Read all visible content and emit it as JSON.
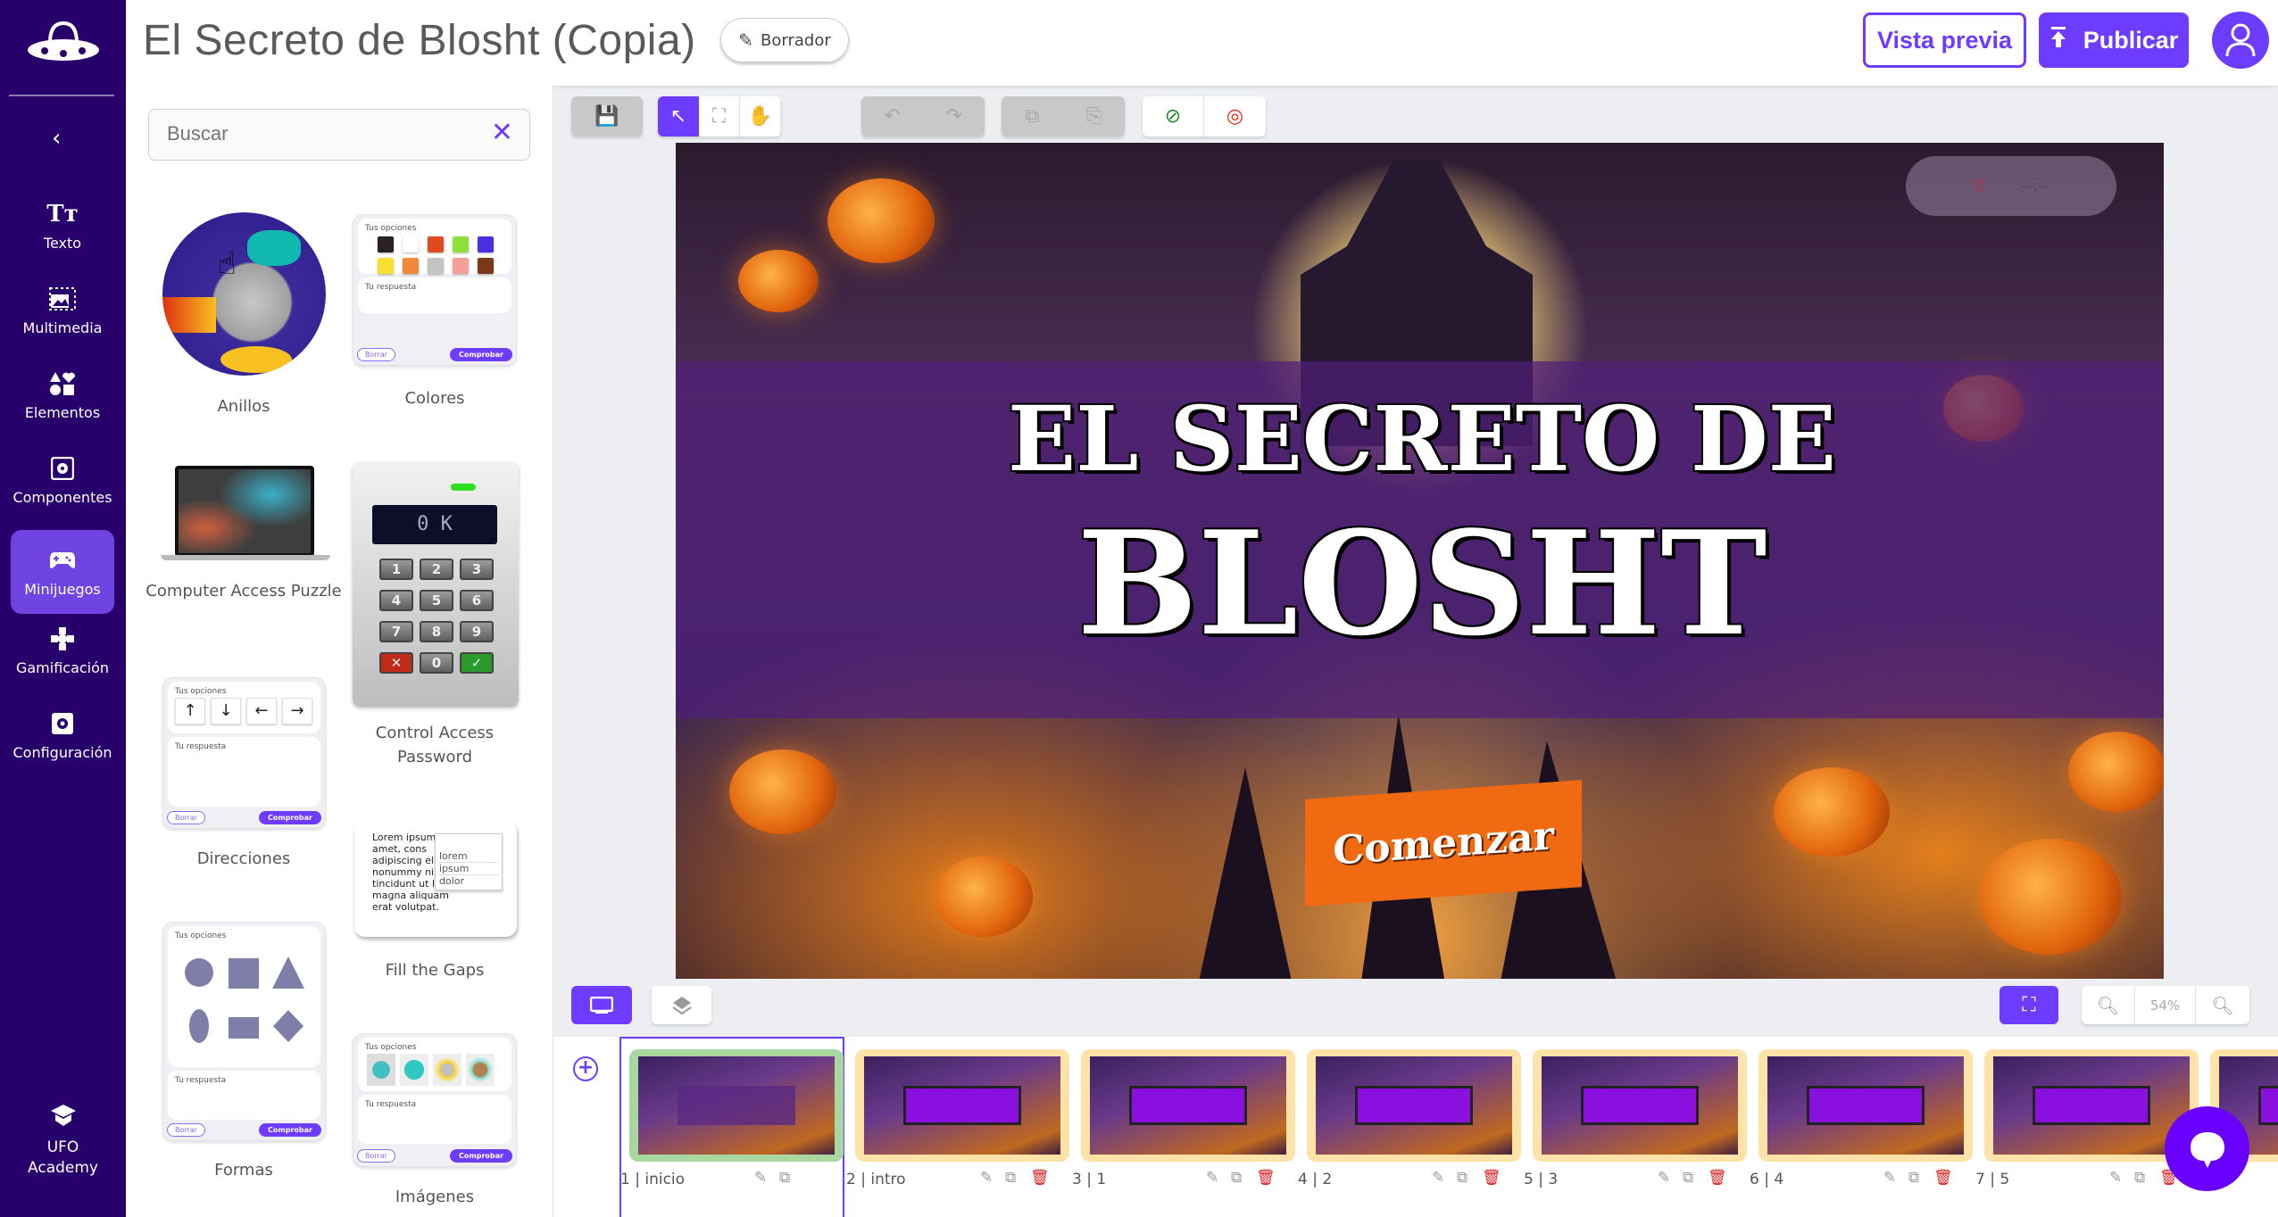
{
  "header": {
    "title": "El Secreto de Blosht (Copia)",
    "status_label": "Borrador",
    "preview_label": "Vista previa",
    "publish_label": "Publicar"
  },
  "sidebar": {
    "items": [
      {
        "label": "Texto",
        "icon": "text-icon"
      },
      {
        "label": "Multimedia",
        "icon": "image-icon"
      },
      {
        "label": "Elementos",
        "icon": "shapes-icon"
      },
      {
        "label": "Componentes",
        "icon": "component-icon"
      },
      {
        "label": "Minijuegos",
        "icon": "gamepad-icon",
        "active": true
      },
      {
        "label": "Gamificación",
        "icon": "puzzle-icon"
      },
      {
        "label": "Configuración",
        "icon": "settings-icon"
      }
    ],
    "academy_label_1": "UFO",
    "academy_label_2": "Academy"
  },
  "search": {
    "placeholder": "Buscar"
  },
  "minigames": {
    "items": [
      {
        "label": "Anillos"
      },
      {
        "label": "Colores"
      },
      {
        "label": "Computer Access Puzzle"
      },
      {
        "label": "Control Access Password"
      },
      {
        "label": "Direcciones"
      },
      {
        "label": "Fill the Gaps"
      },
      {
        "label": "Formas"
      },
      {
        "label": "Imágenes"
      }
    ],
    "options_label": "Tus opciones",
    "answer_label": "Tu respuesta",
    "clear_label": "Borrar",
    "check_label": "Comprobar",
    "colors": [
      "#2a2222",
      "#ffffff",
      "#e04a1c",
      "#8ee03a",
      "#4a30e0",
      "#f8e030",
      "#f08a3a",
      "#c4c4c4",
      "#f4a098",
      "#7a3a1a"
    ],
    "keypad": {
      "display": "0 K",
      "keys": [
        "1",
        "2",
        "3",
        "4",
        "5",
        "6",
        "7",
        "8",
        "9",
        "✕",
        "0",
        "✓"
      ]
    },
    "arrows": [
      "↑",
      "↓",
      "←",
      "→"
    ],
    "fill_gaps": {
      "text": "Lorem ipsum sit amet, cons adipiscing eli nonummy nib tincidunt ut l magna aliquam erat volutpat.",
      "options": [
        "lorem",
        "ipsum",
        "dolor"
      ]
    }
  },
  "slide": {
    "title_line1": "EL SECRETO DE",
    "title_line2": "BLOSHT",
    "start_label": "Comenzar",
    "timer": "--:--"
  },
  "zoom": {
    "level": "54%"
  },
  "slides": [
    {
      "label": "1 | inicio"
    },
    {
      "label": "2 | intro"
    },
    {
      "label": "3 | 1"
    },
    {
      "label": "4 | 2"
    },
    {
      "label": "5 | 3"
    },
    {
      "label": "6 | 4"
    },
    {
      "label": "7 | 5"
    },
    {
      "label": ""
    }
  ],
  "colors": {
    "brand": "#6e3cff",
    "sidebar": "#27006b",
    "active_item": "#6f44e0",
    "thumb_active": "#a8d8a0",
    "thumb": "#fde3a7",
    "delete": "#e21b1b"
  }
}
